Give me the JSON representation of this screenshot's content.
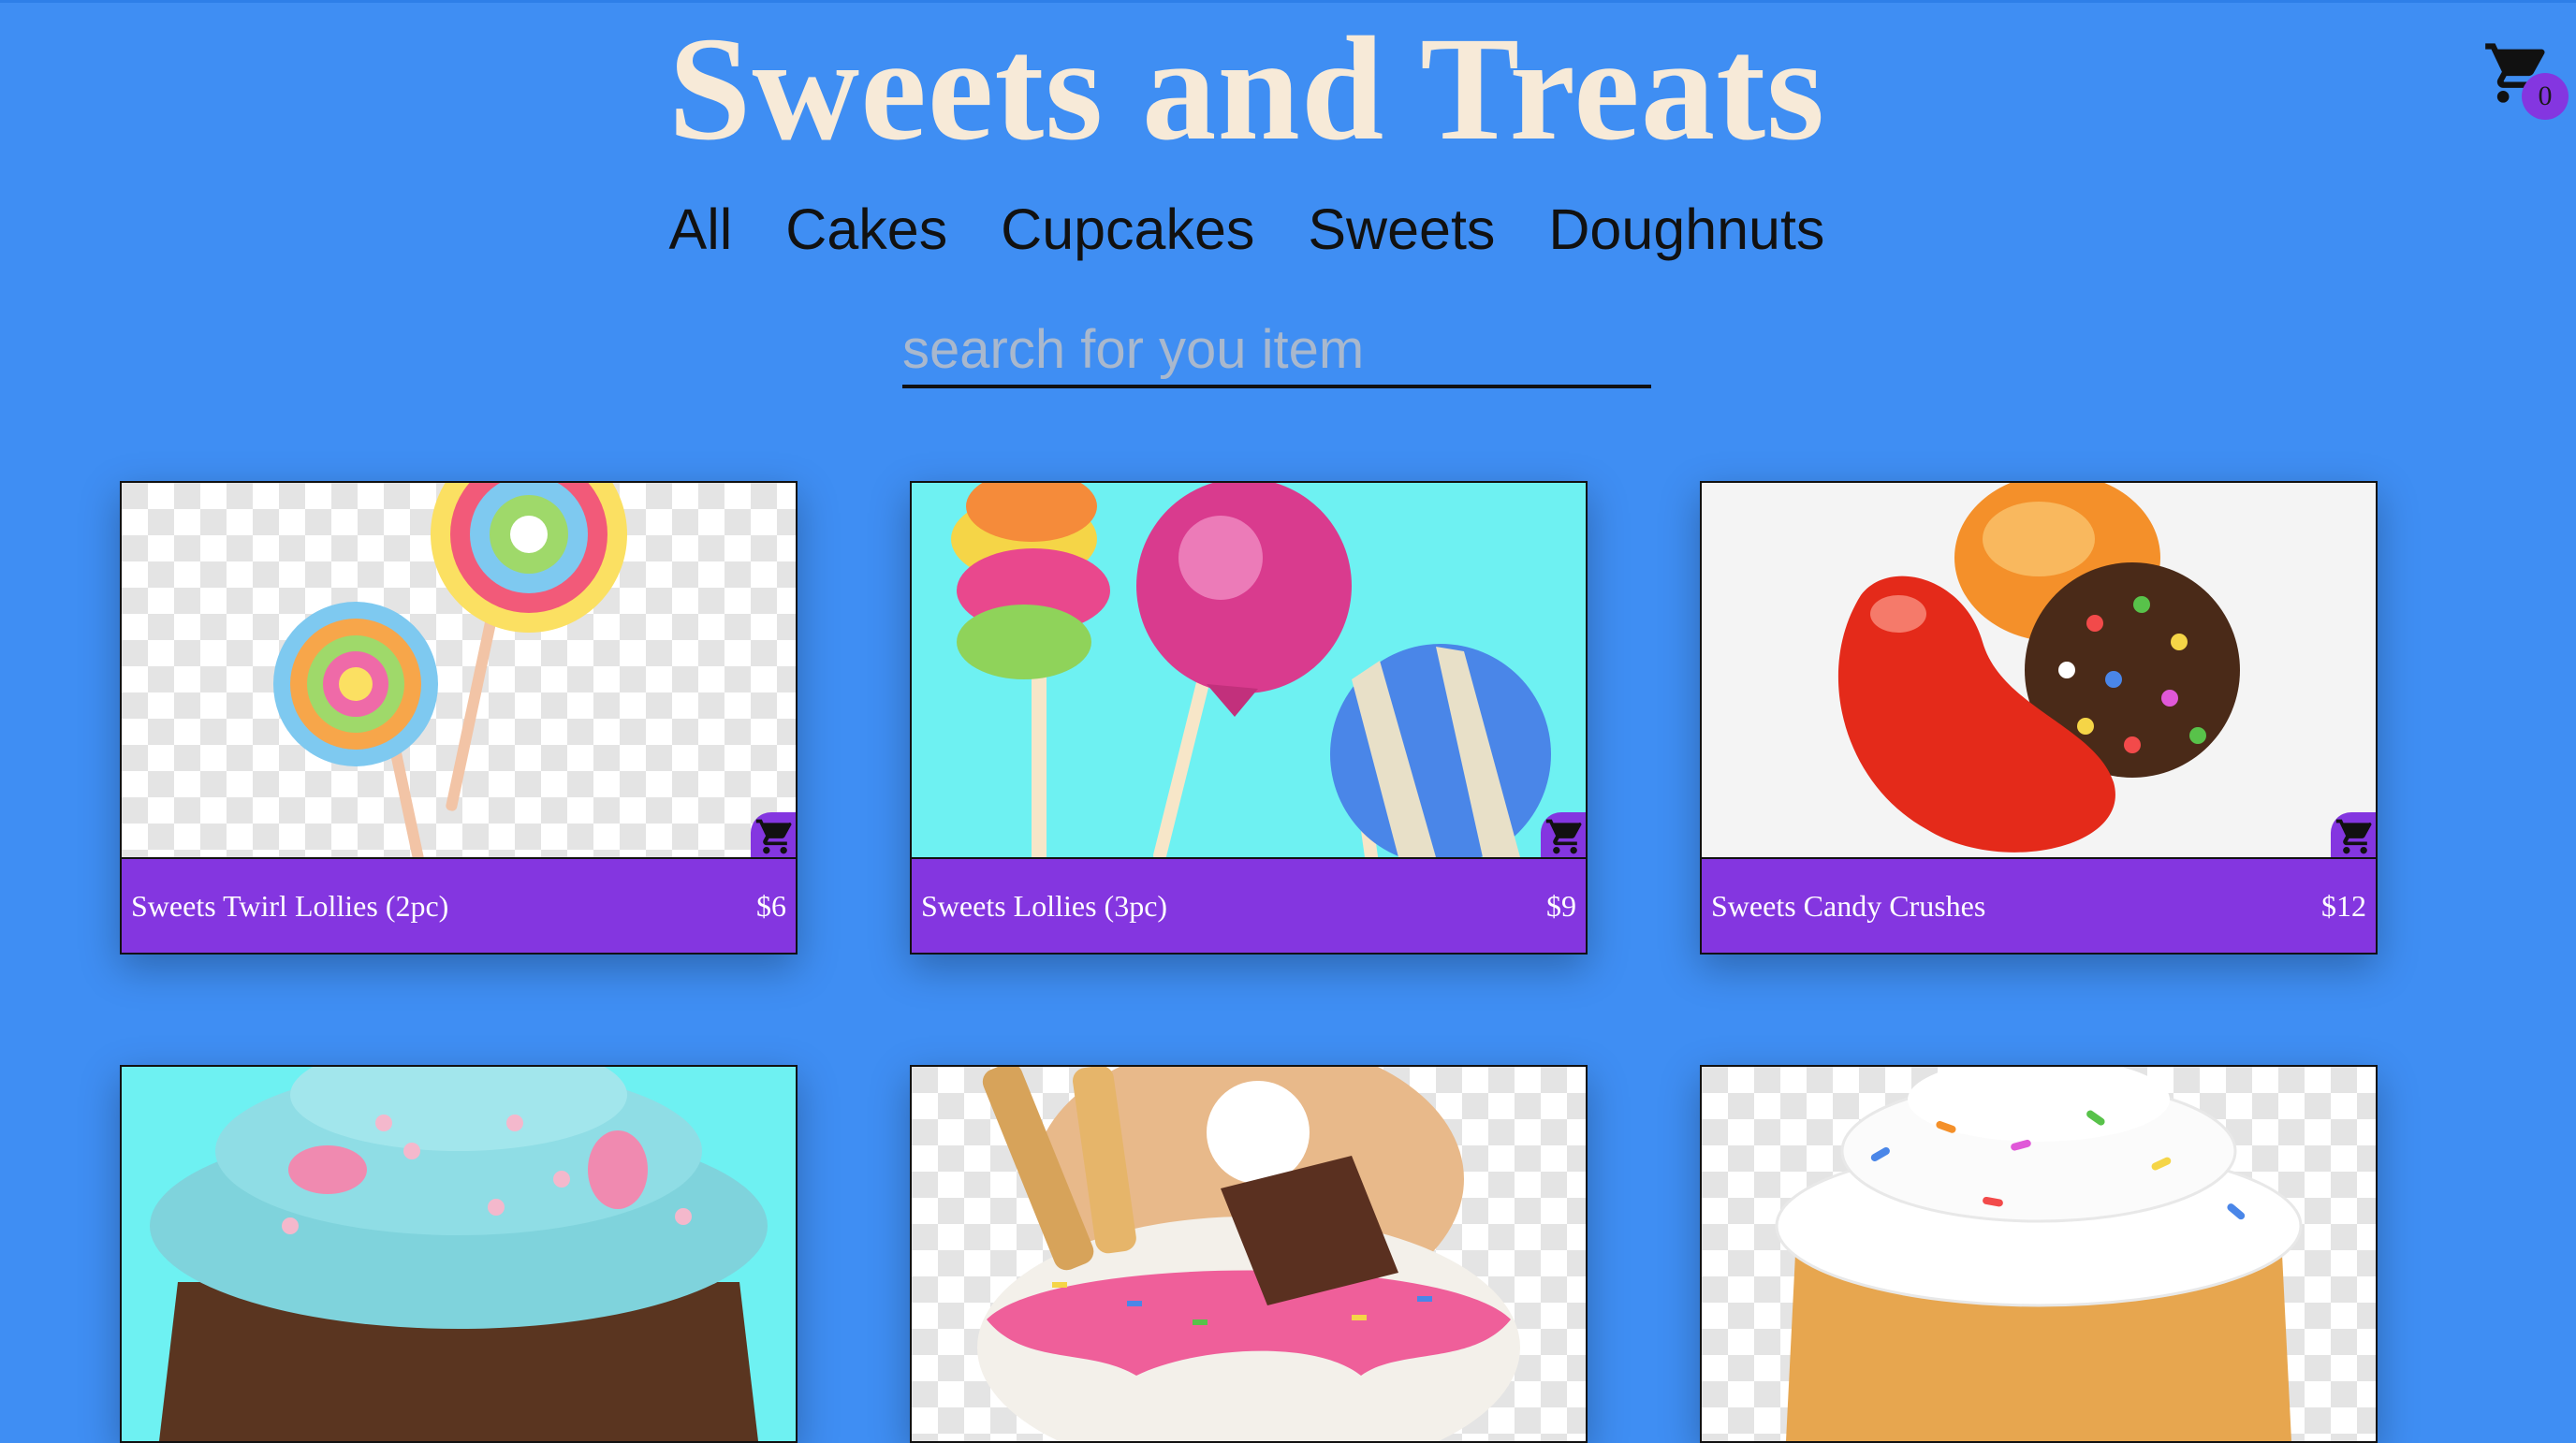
{
  "header": {
    "title": "Sweets and Treats",
    "cart_count": "0"
  },
  "nav": {
    "items": [
      "All",
      "Cakes",
      "Cupcakes",
      "Sweets",
      "Doughnuts"
    ]
  },
  "search": {
    "placeholder": "search for you item",
    "value": ""
  },
  "products": [
    {
      "name": "Sweets Twirl Lollies (2pc)",
      "price": "$6",
      "image": "twirl-lollies"
    },
    {
      "name": "Sweets Lollies (3pc)",
      "price": "$9",
      "image": "lollies"
    },
    {
      "name": "Sweets Candy Crushes",
      "price": "$12",
      "image": "candy-crush"
    },
    {
      "name": "",
      "price": "",
      "image": "blue-cupcake"
    },
    {
      "name": "",
      "price": "",
      "image": "doughnut"
    },
    {
      "name": "",
      "price": "",
      "image": "vanilla-cupcake"
    }
  ],
  "colors": {
    "background": "#3f8ef3",
    "accent": "#8436e0",
    "title": "#f7ead8"
  },
  "icons": {
    "cart": "shopping-cart-icon",
    "add_to_cart": "add-to-cart-icon"
  }
}
